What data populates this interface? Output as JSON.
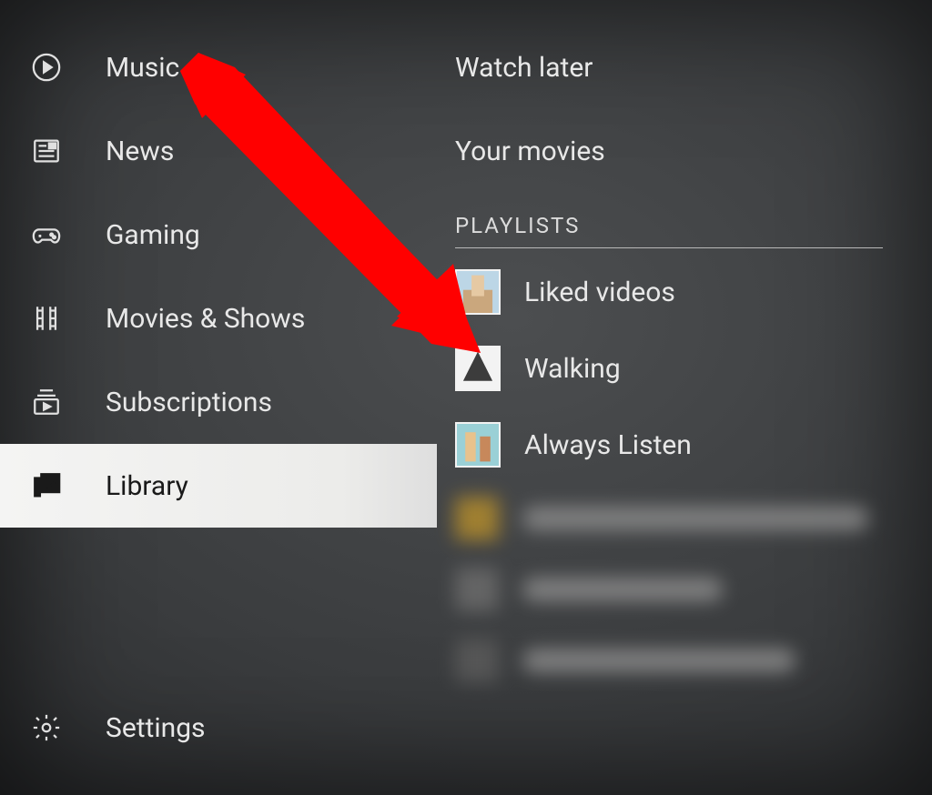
{
  "sidebar": {
    "items": [
      {
        "id": "music",
        "label": "Music",
        "icon": "music-icon"
      },
      {
        "id": "news",
        "label": "News",
        "icon": "news-icon"
      },
      {
        "id": "gaming",
        "label": "Gaming",
        "icon": "gaming-icon"
      },
      {
        "id": "movies-shows",
        "label": "Movies & Shows",
        "icon": "film-icon"
      },
      {
        "id": "subscriptions",
        "label": "Subscriptions",
        "icon": "subscriptions-icon"
      },
      {
        "id": "library",
        "label": "Library",
        "icon": "library-icon",
        "selected": true
      }
    ],
    "settings_label": "Settings"
  },
  "content": {
    "top_items": [
      {
        "label": "Watch later"
      },
      {
        "label": "Your movies"
      }
    ],
    "playlists_header": "PLAYLISTS",
    "playlists": [
      {
        "label": "Liked videos"
      },
      {
        "label": "Walking"
      },
      {
        "label": "Always Listen"
      }
    ]
  },
  "annotation": {
    "type": "arrow",
    "color": "#ff0000",
    "target": "playlist-liked-videos"
  }
}
